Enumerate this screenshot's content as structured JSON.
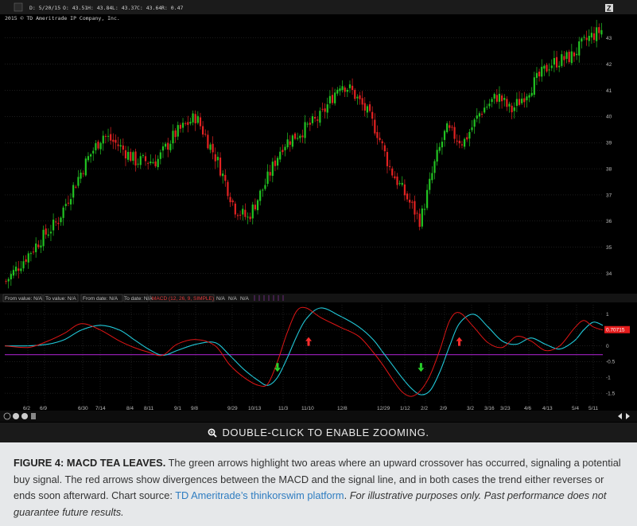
{
  "header": {
    "date": "D: 5/20/15",
    "open": "O: 43.51",
    "high": "H: 43.84",
    "low": "L: 43.37",
    "close": "C: 43.64",
    "range": "R: 0.47",
    "copyright": "2015 © TD Ameritrade IP Company, Inc."
  },
  "status_bar": {
    "from_value": "From value: N/A",
    "to_value": "To value: N/A",
    "from_date": "From date: N/A",
    "to_date": "To date: N/A",
    "macd_label": "MACD (12, 26, 9, SIMPLE)",
    "na1": "N/A",
    "na2": "N/A",
    "na3": "N/A"
  },
  "zoom_bar": {
    "label": "DOUBLE-CLICK TO ENABLE ZOOMING."
  },
  "caption": {
    "title": "FIGURE 4: MACD TEA LEAVES.",
    "body": " The green arrows highlight two areas where an upward crossover has occurred, signaling a potential buy signal. The red arrows show divergences between the MACD and the signal line, and in both cases the trend either reverses or ends soon afterward. Chart source: ",
    "link": "TD Ameritrade’s thinkorswim platform",
    "after_link": ". ",
    "italic": "For illustrative purposes only. Past performance does not guarantee future results."
  },
  "colors": {
    "up": "#22c322",
    "down": "#e32222",
    "macd": "#e01515",
    "signal": "#20c8d8",
    "zero_line": "#a020c0",
    "badge": "#e51c1c",
    "bg": "#000000",
    "grid": "#3a3a3a"
  },
  "icons": [
    "zoom-icon",
    "zoom-in-icon",
    "zoom-out-icon",
    "scroll-left-icon",
    "scroll-right-icon",
    "crosshair-icon"
  ],
  "chart_data": [
    {
      "type": "candlestick",
      "y_ticks": [
        34,
        35,
        36,
        37,
        38,
        39,
        40,
        41,
        42,
        43
      ],
      "ylim": [
        33.5,
        43.6
      ],
      "x_tick_labels": [
        "6/2",
        "6/9",
        "6/30",
        "7/14",
        "8/4",
        "8/11",
        "9/1",
        "9/8",
        "9/29",
        "10/13",
        "11/3",
        "11/10",
        "12/8",
        "12/29",
        "1/12",
        "2/2",
        "2/9",
        "3/2",
        "3/16",
        "3/23",
        "4/6",
        "4/13",
        "5/4",
        "5/11"
      ],
      "path_points": [
        [
          0,
          33.7
        ],
        [
          8,
          34.5
        ],
        [
          16,
          35.3
        ],
        [
          24,
          36.0
        ],
        [
          30,
          37.1
        ],
        [
          38,
          38.4
        ],
        [
          45,
          39.3
        ],
        [
          52,
          38.9
        ],
        [
          60,
          38.3
        ],
        [
          70,
          38.3
        ],
        [
          78,
          39.3
        ],
        [
          88,
          40.0
        ],
        [
          98,
          38.3
        ],
        [
          106,
          36.5
        ],
        [
          112,
          36.1
        ],
        [
          120,
          37.4
        ],
        [
          128,
          38.9
        ],
        [
          138,
          39.5
        ],
        [
          146,
          40.0
        ],
        [
          155,
          41.3
        ],
        [
          160,
          41.0
        ],
        [
          167,
          40.2
        ],
        [
          172,
          39.4
        ],
        [
          178,
          38.0
        ],
        [
          185,
          37.0
        ],
        [
          192,
          36.0
        ],
        [
          199,
          38.3
        ],
        [
          204,
          39.5
        ],
        [
          212,
          39.0
        ],
        [
          220,
          40.2
        ],
        [
          228,
          40.8
        ],
        [
          234,
          40.2
        ],
        [
          242,
          41.0
        ],
        [
          252,
          42.0
        ],
        [
          262,
          42.3
        ],
        [
          270,
          43.0
        ],
        [
          276,
          43.3
        ]
      ],
      "n_bars": 240
    },
    {
      "type": "line",
      "ylim": [
        -1.85,
        1.3
      ],
      "y_ticks": [
        1,
        0.5,
        0,
        -0.5,
        -1,
        -1.5
      ],
      "y_tick_labels": [
        "1",
        "0.5",
        "0",
        "-0.5",
        "-1",
        "-1.5"
      ],
      "last_value": "0.70715",
      "macd_points": [
        [
          0,
          0
        ],
        [
          10,
          -0.05
        ],
        [
          18,
          0.15
        ],
        [
          25,
          0.4
        ],
        [
          32,
          0.7
        ],
        [
          40,
          0.5
        ],
        [
          48,
          0.15
        ],
        [
          54,
          -0.05
        ],
        [
          60,
          -0.2
        ],
        [
          66,
          -0.3
        ],
        [
          72,
          0.05
        ],
        [
          80,
          0.2
        ],
        [
          88,
          0
        ],
        [
          94,
          -0.6
        ],
        [
          100,
          -1.0
        ],
        [
          106,
          -1.25
        ],
        [
          110,
          -1.2
        ],
        [
          114,
          -0.5
        ],
        [
          118,
          0.4
        ],
        [
          122,
          1.1
        ],
        [
          126,
          1.2
        ],
        [
          132,
          0.9
        ],
        [
          140,
          0.6
        ],
        [
          148,
          0.3
        ],
        [
          154,
          -0.2
        ],
        [
          158,
          -0.6
        ],
        [
          162,
          -1.05
        ],
        [
          166,
          -1.45
        ],
        [
          170,
          -1.6
        ],
        [
          174,
          -1.4
        ],
        [
          178,
          -0.9
        ],
        [
          182,
          -0.1
        ],
        [
          186,
          0.8
        ],
        [
          190,
          1.05
        ],
        [
          196,
          0.6
        ],
        [
          202,
          0.1
        ],
        [
          208,
          -0.05
        ],
        [
          214,
          0.3
        ],
        [
          220,
          0.15
        ],
        [
          226,
          -0.15
        ],
        [
          232,
          0
        ],
        [
          238,
          0.55
        ],
        [
          242,
          0.8
        ],
        [
          246,
          0.6
        ],
        [
          250,
          0.5
        ]
      ],
      "signal_points": [
        [
          0,
          0
        ],
        [
          10,
          0
        ],
        [
          18,
          0.05
        ],
        [
          25,
          0.2
        ],
        [
          32,
          0.5
        ],
        [
          40,
          0.65
        ],
        [
          48,
          0.5
        ],
        [
          54,
          0.2
        ],
        [
          60,
          -0.1
        ],
        [
          66,
          -0.3
        ],
        [
          72,
          -0.15
        ],
        [
          80,
          0.05
        ],
        [
          88,
          0.1
        ],
        [
          94,
          -0.3
        ],
        [
          100,
          -0.75
        ],
        [
          106,
          -1.1
        ],
        [
          110,
          -1.25
        ],
        [
          114,
          -1.0
        ],
        [
          118,
          -0.4
        ],
        [
          122,
          0.3
        ],
        [
          126,
          0.85
        ],
        [
          132,
          1.2
        ],
        [
          140,
          0.95
        ],
        [
          148,
          0.6
        ],
        [
          154,
          0.2
        ],
        [
          158,
          -0.2
        ],
        [
          162,
          -0.6
        ],
        [
          166,
          -1.0
        ],
        [
          170,
          -1.35
        ],
        [
          174,
          -1.55
        ],
        [
          178,
          -1.4
        ],
        [
          182,
          -0.8
        ],
        [
          186,
          0
        ],
        [
          190,
          0.7
        ],
        [
          196,
          1.0
        ],
        [
          202,
          0.6
        ],
        [
          208,
          0.15
        ],
        [
          214,
          0.05
        ],
        [
          220,
          0.25
        ],
        [
          226,
          0.05
        ],
        [
          232,
          -0.1
        ],
        [
          238,
          0.15
        ],
        [
          242,
          0.5
        ],
        [
          246,
          0.75
        ],
        [
          250,
          0.65
        ]
      ],
      "signal_marker_level": -0.28,
      "annotations": [
        {
          "kind": "green-up-arrow",
          "x_index": 114,
          "macd": -1.25
        },
        {
          "kind": "red-up-arrow",
          "x_index": 127,
          "macd": 0.1
        },
        {
          "kind": "green-up-arrow",
          "x_index": 174,
          "macd": -1.25
        },
        {
          "kind": "red-up-arrow",
          "x_index": 190,
          "macd": 0.1
        }
      ]
    }
  ]
}
